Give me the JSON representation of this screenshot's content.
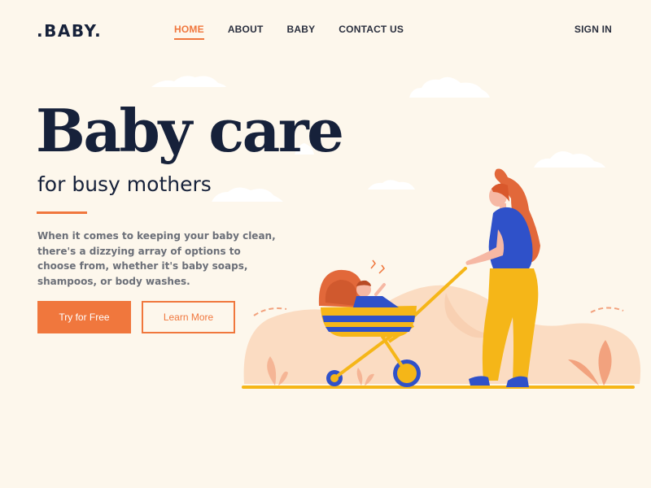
{
  "logo": ".BABY.",
  "nav": {
    "items": [
      {
        "label": "HOME",
        "active": true
      },
      {
        "label": "ABOUT"
      },
      {
        "label": "BABY"
      },
      {
        "label": "CONTACT US"
      }
    ],
    "sign_in": "SIGN IN"
  },
  "hero": {
    "title": "Baby care",
    "subtitle": "for busy mothers",
    "description": "When it comes to keeping your baby clean, there's a dizzying array of options to choose from, whether it's baby soaps, shampoos, or body washes.",
    "primary_button": "Try for Free",
    "secondary_button": "Learn More"
  },
  "colors": {
    "accent": "#f0773d",
    "text_dark": "#16213a",
    "background": "#fdf7ec"
  },
  "illustration": {
    "subject": "mother-pushing-baby-stroller-icon"
  }
}
